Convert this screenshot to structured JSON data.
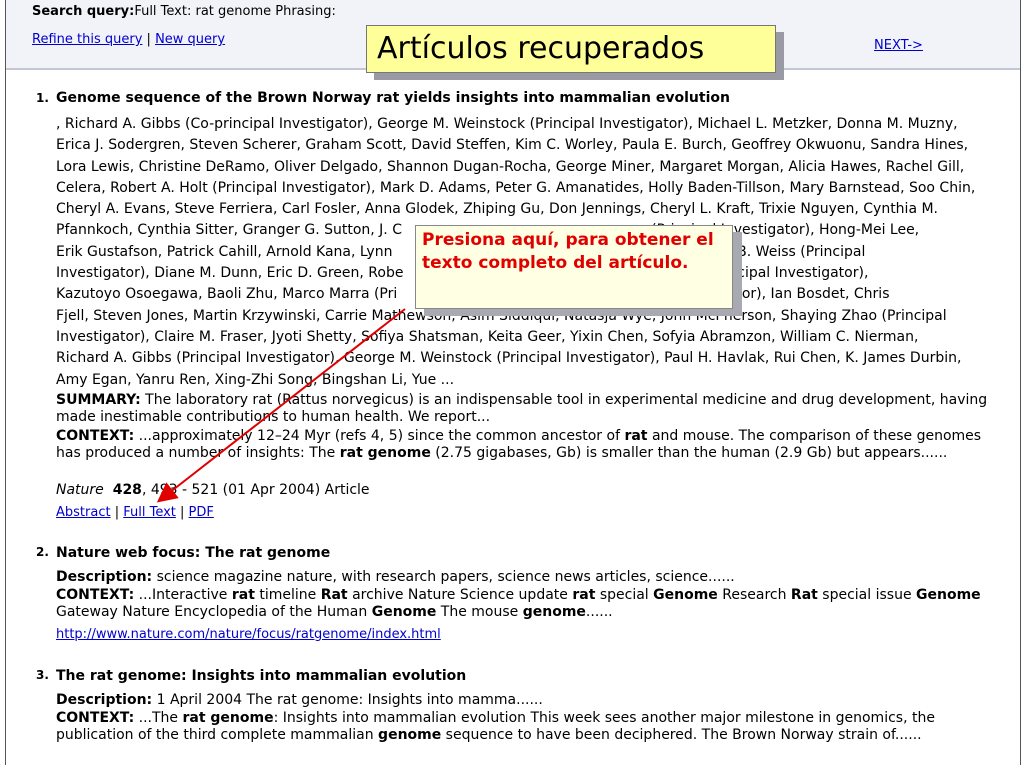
{
  "header": {
    "search_query_label": "Search query:",
    "search_query_value": "Full Text: rat genome Phrasing:",
    "refine_link": "Refine this query",
    "separator": "|",
    "new_query_link": "New query",
    "next_link": "NEXT->"
  },
  "banner": {
    "text": "Artículos recuperados"
  },
  "callout": {
    "text": "Presiona aquí, para obtener el texto completo del artículo."
  },
  "results": {
    "r1": {
      "number": "1.",
      "title": "Genome sequence of the Brown Norway rat yields insights into mammalian evolution",
      "authors": [
        ", Richard A. Gibbs (Co-principal Investigator), George M. Weinstock (Principal Investigator), Michael L. Metzker, Donna M. Muzny,",
        "Erica J. Sodergren, Steven Scherer, Graham Scott, David Steffen, Kim C. Worley, Paula E. Burch, Geoffrey Okwuonu, Sandra Hines,",
        "Lora Lewis, Christine DeRamo, Oliver Delgado, Shannon Dugan-Rocha, George Miner, Margaret Morgan, Alicia Hawes, Rachel Gill,",
        "Celera, Robert A. Holt (Principal Investigator), Mark D. Adams, Peter G. Amanatides, Holly Baden-Tillson, Mary Barnstead, Soo Chin,",
        "Cheryl A. Evans, Steve Ferriera, Carl Fosler, Anna Glodek, Zhiping Gu, Don Jennings, Cheryl L. Kraft, Trixie Nguyen, Cynthia M.",
        "Pfannkoch, Cynthia Sitter, Granger G. Sutton, J. C                                                        (Principal Investigator), Hong-Mei Lee,",
        "Erik Gustafson, Patrick Cahill, Arnold Kana, Lynn                                                          htel, Robert B. Weiss (Principal",
        "Investigator), Diane M. Dunn, Eric D. Green, Robe                                                       de Jong (Principal Investigator),",
        "Kazutoyo Osoegawa, Baoli Zhu, Marco Marra (Pri                                                          al Investigator), Ian Bosdet, Chris",
        "Fjell, Steven Jones, Martin Krzywinski, Carrie Mathewson, Asim Siddiqui, Natasja Wye, John McPherson, Shaying Zhao (Principal",
        "Investigator), Claire M. Fraser, Jyoti Shetty, Sofiya Shatsman, Keita Geer, Yixin Chen, Sofyia Abramzon, William C. Nierman,",
        "Richard A. Gibbs (Principal Investigator), George M. Weinstock (Principal Investigator), Paul H. Havlak, Rui Chen, K. James Durbin,",
        "Amy Egan, Yanru Ren, Xing-Zhi Song, Bingshan Li, Yue ..."
      ],
      "summary_label": "SUMMARY:",
      "summary_text": " The laboratory rat (Rattus norvegicus) is an indispensable tool in experimental medicine and drug development, having made inestimable contributions to human health. We report...",
      "context_label": "CONTEXT:",
      "context_a": " ...approximately 12–24 Myr (refs 4, 5) since the common ancestor of ",
      "context_b": "rat",
      "context_c": " and mouse. The comparison of these genomes has produced a number of insights: The ",
      "context_d": "rat genome",
      "context_e": " (2.75 gigabases, Gb) is smaller than the human (2.9 Gb) but appears......",
      "journal": "Nature",
      "volume": "428",
      "citation": ", 493 - 521 (01 Apr 2004) Article",
      "link_abstract": "Abstract",
      "link_fulltext": "Full Text",
      "link_pdf": "PDF"
    },
    "r2": {
      "number": "2.",
      "title": "Nature web focus: The rat genome",
      "desc_label": "Description:",
      "desc_text": " science magazine nature, with research papers, science news articles, science......",
      "context_label": "CONTEXT:",
      "c1": " ...Interactive ",
      "c2": "rat",
      "c3": " timeline ",
      "c4": "Rat",
      "c5": " archive Nature Science update ",
      "c6": "rat",
      "c7": " special ",
      "c8": "Genome",
      "c9": " Research ",
      "c10": "Rat",
      "c11": " special issue ",
      "c12": "Genome",
      "c13": " Gateway Nature Encyclopedia of the Human ",
      "c14": "Genome",
      "c15": " The mouse ",
      "c16": "genome",
      "c17": "......",
      "url": "http://www.nature.com/nature/focus/ratgenome/index.html"
    },
    "r3": {
      "number": "3.",
      "title": "The rat genome: Insights into mammalian evolution",
      "desc_label": "Description:",
      "desc_text": " 1 April 2004 The rat genome: Insights into mamma......",
      "context_label": "CONTEXT:",
      "c1": " ...The ",
      "c2": "rat genome",
      "c3": ": Insights into mammalian evolution This week sees another major milestone in genomics, the publication of the third complete mammalian ",
      "c4": "genome",
      "c5": " sequence to have been deciphered. The Brown Norway strain of......"
    }
  },
  "colors": {
    "link": "#0000cc",
    "banner_bg": "#ffff99",
    "callout_text": "#e00000",
    "arrow": "#e00000"
  }
}
